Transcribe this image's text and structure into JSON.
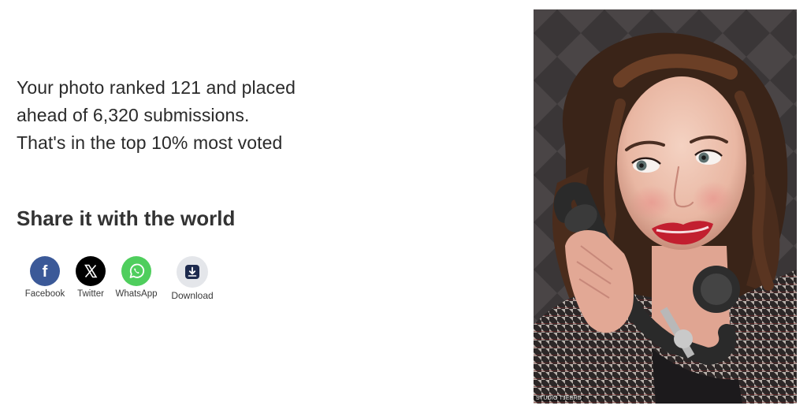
{
  "summary": {
    "line1": "Your photo ranked 121 and placed",
    "line2": "ahead of 6,320 submissions.",
    "line3": "That's in the top 10% most voted"
  },
  "share": {
    "title": "Share it with the world",
    "buttons": [
      {
        "label": "Facebook",
        "icon": "facebook-icon",
        "color": "#3b5998"
      },
      {
        "label": "Twitter",
        "icon": "x-twitter-icon",
        "color": "#000000"
      },
      {
        "label": "WhatsApp",
        "icon": "whatsapp-icon",
        "color": "#4fce5d"
      },
      {
        "label": "Download",
        "icon": "download-icon",
        "color": "#e4e6ea"
      }
    ]
  },
  "photo": {
    "watermark": "STUDIO TJEERD"
  }
}
